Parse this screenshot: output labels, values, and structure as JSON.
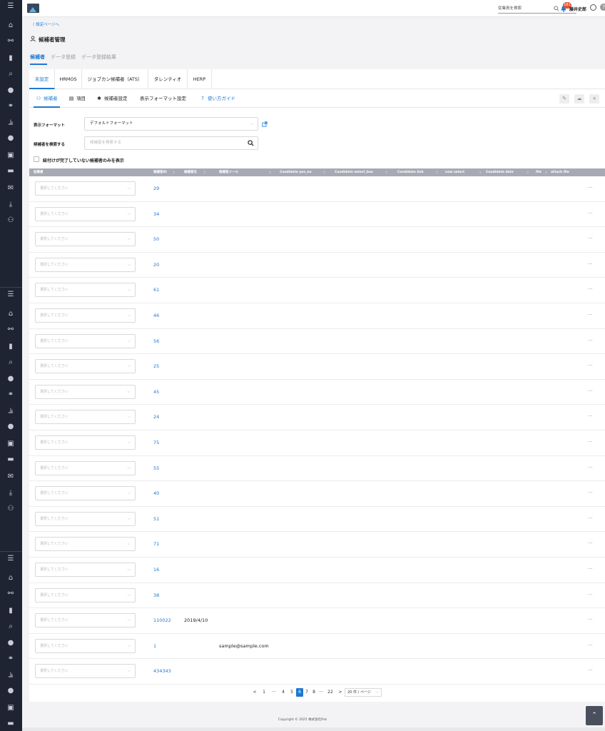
{
  "topbar": {
    "search_placeholder": "従業員を検索",
    "notification_count": "181",
    "username": "藤井史郎",
    "help": "?"
  },
  "back_link": "〈 設定ページへ",
  "page_title": "候補者管理",
  "main_tabs": [
    "候補者",
    "データ登録",
    "データ登録結果"
  ],
  "source_tabs": [
    "未設定",
    "HRMOS",
    "ジョブカン候補者（ATS）",
    "タレンティオ",
    "HERP"
  ],
  "sub_tabs": {
    "candidates": "候補者",
    "items": "項目",
    "settings": "候補者設定",
    "format_settings": "表示フォーマット設定",
    "guide": "使い方ガイド"
  },
  "form": {
    "format_label": "表示フォーマット",
    "format_value": "デフォルトフォーマット",
    "search_label": "候補者を検索する",
    "search_placeholder": "候補者を検索する",
    "checkbox_label": "紐付けが完了していない候補者のみを表示"
  },
  "table": {
    "columns": [
      "従業員",
      "候補者ID",
      "候補者名",
      "候補者メール",
      "Candidate yes_no",
      "Candidate select_box",
      "Candidate link",
      "new select",
      "Candidate date",
      "file",
      "attach file"
    ],
    "select_placeholder": "選択してください",
    "more": "···",
    "rows": [
      {
        "id": "29",
        "name": "",
        "email": ""
      },
      {
        "id": "34",
        "name": "",
        "email": ""
      },
      {
        "id": "50",
        "name": "",
        "email": ""
      },
      {
        "id": "20",
        "name": "",
        "email": ""
      },
      {
        "id": "61",
        "name": "",
        "email": ""
      },
      {
        "id": "46",
        "name": "",
        "email": ""
      },
      {
        "id": "56",
        "name": "",
        "email": ""
      },
      {
        "id": "25",
        "name": "",
        "email": ""
      },
      {
        "id": "45",
        "name": "",
        "email": ""
      },
      {
        "id": "24",
        "name": "",
        "email": ""
      },
      {
        "id": "75",
        "name": "",
        "email": ""
      },
      {
        "id": "55",
        "name": "",
        "email": ""
      },
      {
        "id": "40",
        "name": "",
        "email": ""
      },
      {
        "id": "51",
        "name": "",
        "email": ""
      },
      {
        "id": "71",
        "name": "",
        "email": ""
      },
      {
        "id": "16",
        "name": "",
        "email": ""
      },
      {
        "id": "38",
        "name": "",
        "email": ""
      },
      {
        "id": "110022",
        "name": "2019/4/10",
        "email": ""
      },
      {
        "id": "1",
        "name": "",
        "email": "sample@sample.com"
      },
      {
        "id": "434343",
        "name": "",
        "email": ""
      }
    ]
  },
  "pagination": {
    "prev": "<",
    "next": ">",
    "pages": [
      "1",
      "···",
      "4",
      "5",
      "6",
      "7",
      "8",
      "···",
      "22"
    ],
    "current": "6",
    "page_size": "20 件 / ページ"
  },
  "copyright": "Copyright © 2025 株式会社Rsk",
  "colors": {
    "accent": "#1f78d1",
    "sidebar": "#1f2433",
    "header": "#a7aab5"
  }
}
